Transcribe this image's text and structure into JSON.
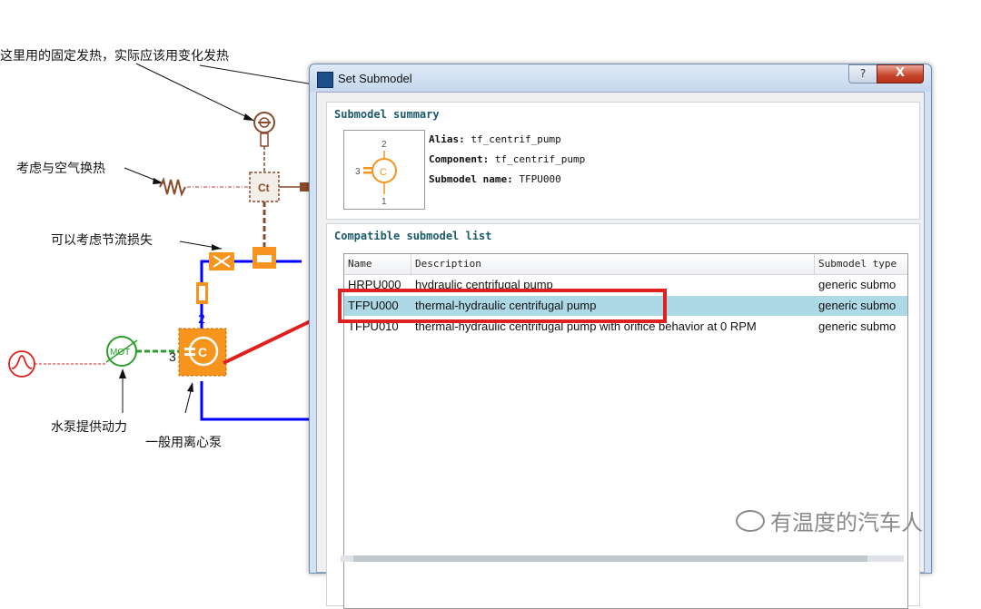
{
  "annotations": {
    "fixed_heat": "这里用的固定发热，实际应该用变化发热",
    "air_exchange": "考虑与空气换热",
    "throttle_loss": "可以考虑节流损失",
    "pump_power": "水泵提供动力",
    "centrifugal_pump": "一般用离心泵"
  },
  "sketch": {
    "ct_label": "Ct",
    "mot_label": "MOT",
    "pump_port_2": "2",
    "pump_port_3": "3",
    "pump_letter": "C"
  },
  "dialog": {
    "title": "Set Submodel",
    "help_label": "?",
    "close_label": "X",
    "summary": {
      "heading": "Submodel summary",
      "icon_port_top": "2",
      "icon_port_left": "3",
      "icon_port_bottom": "1",
      "icon_letter": "C",
      "alias_label": "Alias:",
      "alias_value": "tf_centrif_pump",
      "component_label": "Component:",
      "component_value": "tf_centrif_pump",
      "name_label": "Submodel name:",
      "name_value": "TFPU000"
    },
    "list": {
      "heading": "Compatible submodel list",
      "columns": [
        "Name",
        "Description",
        "Submodel type"
      ],
      "rows": [
        {
          "name": "HRPU000",
          "description": "hydraulic centrifugal pump",
          "type": "generic submo"
        },
        {
          "name": "TFPU000",
          "description": "thermal-hydraulic centrifugal pump",
          "type": "generic submo"
        },
        {
          "name": "TFPU010",
          "description": "thermal-hydraulic centrifugal pump with orifice behavior at 0 RPM",
          "type": "generic submo"
        }
      ]
    }
  },
  "watermark": "有温度的汽车人",
  "colors": {
    "pump_orange": "#f7941d",
    "hydraulic_brown": "#8b4a2a",
    "flow_blue": "#0000ff",
    "motor_green": "#2aa02a",
    "signal_red": "#e02020",
    "selection": "#add9e6"
  }
}
